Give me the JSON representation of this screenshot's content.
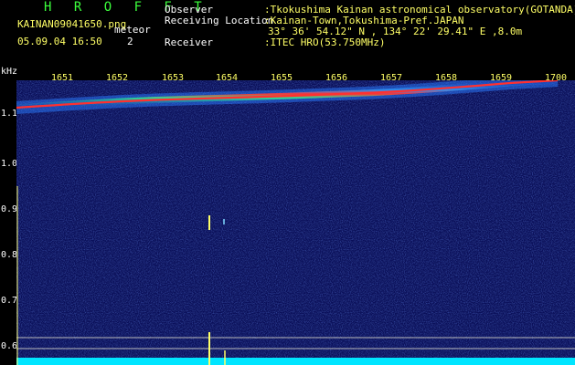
{
  "header": {
    "title": "H R O F F T",
    "filename": "KAINAN09041650.png",
    "meteor_label": "meteor",
    "datetime": "05.09.04 16:50",
    "meteor_count": "2"
  },
  "info": {
    "observer_label": "Observer",
    "observer_value": ":Tkokushima Kainan astronomical observatory(GOTANDA)",
    "location_label": "Receiving Location",
    "location_value": ":Kainan-Town,Tokushima-Pref.JAPAN",
    "coords_value": "33° 36' 54.12\" N , 134° 22' 29.41\" E ,8.0m",
    "receiver_label": "Receiver",
    "receiver_value": ":ITEC HRO(53.750MHz)"
  },
  "axes": {
    "y_unit": "kHz",
    "y_ticks": [
      "1.1",
      "1.0",
      "0.9",
      "0.8",
      "0.7",
      "0.6"
    ],
    "x_ticks": [
      "1651",
      "1652",
      "1653",
      "1654",
      "1655",
      "1656",
      "1657",
      "1658",
      "1659",
      "1700"
    ]
  },
  "colors": {
    "background": "#000000",
    "spectrogram_bg": "#0a0f5a",
    "trace": "#ff3030",
    "noise_floor": "#00e5ff",
    "meteor": "#ffff66"
  }
}
